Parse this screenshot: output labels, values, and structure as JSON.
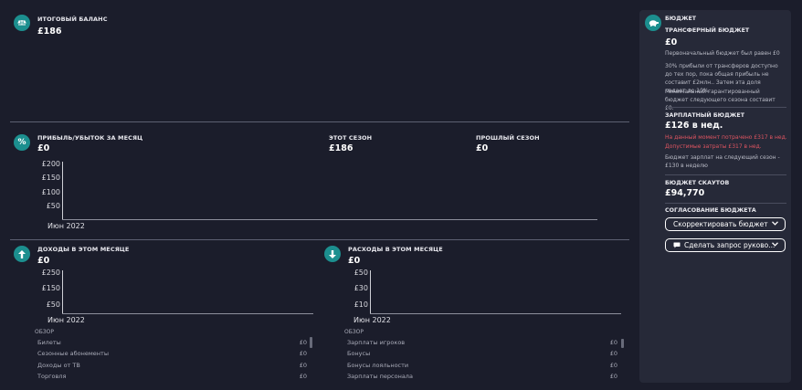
{
  "balance": {
    "title": "ИТОГОВЫЙ БАЛАНС",
    "value": "£186"
  },
  "monthly": {
    "title": "ПРИБЫЛЬ/УБЫТОК ЗА МЕСЯЦ",
    "value": "£0",
    "this_season_title": "ЭТОТ СЕЗОН",
    "this_season_value": "£186",
    "last_season_title": "ПРОШЛЫЙ СЕЗОН",
    "last_season_value": "£0",
    "ticks": [
      "£200",
      "£150",
      "£100",
      "£50"
    ],
    "xlabel": "Июн 2022"
  },
  "income": {
    "title": "ДОХОДЫ В ЭТОМ МЕСЯЦЕ",
    "value": "£0",
    "ticks": [
      "£250",
      "£150",
      "£50"
    ],
    "xlabel": "Июн 2022",
    "overview": "ОБЗОР",
    "rows": [
      {
        "label": "Билеты",
        "value": "£0"
      },
      {
        "label": "Сезонные абонементы",
        "value": "£0"
      },
      {
        "label": "Доходы от ТВ",
        "value": "£0"
      },
      {
        "label": "Торговля",
        "value": "£0"
      }
    ]
  },
  "expenses": {
    "title": "РАСХОДЫ В ЭТОМ МЕСЯЦЕ",
    "value": "£0",
    "ticks": [
      "£50",
      "£30",
      "£10"
    ],
    "xlabel": "Июн 2022",
    "overview": "ОБЗОР",
    "rows": [
      {
        "label": "Зарплаты игроков",
        "value": "£0"
      },
      {
        "label": "Бонусы",
        "value": "£0"
      },
      {
        "label": "Бонусы лояльности",
        "value": "£0"
      },
      {
        "label": "Зарплаты персонала",
        "value": "£0"
      }
    ]
  },
  "budget": {
    "header": "БЮДЖЕТ",
    "transfer_title": "ТРАНСФЕРНЫЙ БЮДЖЕТ",
    "transfer_value": "£0",
    "transfer_text1": "Первоначальный бюджет был равен £0",
    "transfer_text2": "30% прибыли от трансферов доступно до тех пор, пока общая прибыль не составит £2млн.. Затем эта доля падает до 10%.",
    "transfer_text3": "Минимальный гарантированный бюджет следующего сезона составит £0.",
    "wage_title": "ЗАРПЛАТНЫЙ БЮДЖЕТ",
    "wage_value": "£126 в нед.",
    "wage_spent": "На данный момент потрачено £317 в нед.",
    "wage_allowed": "Допустимые затраты £317 в нед.",
    "wage_next": "Бюджет зарплат на следующий сезон - £130 в неделю",
    "scout_title": "БЮДЖЕТ СКАУТОВ",
    "scout_value": "£94,770",
    "approval_title": "СОГЛАСОВАНИЕ БЮДЖЕТА",
    "adjust_button": "Скорректировать бюджет",
    "request_button": "Сделать запрос руково..."
  },
  "colors": {
    "accent": "#1c8f8f",
    "background": "#1b1d2b",
    "panel": "#262938",
    "warning": "#e05561"
  },
  "icons": {
    "balance": "scale-icon",
    "monthly": "percent-icon",
    "income": "arrow-up-icon",
    "expenses": "arrow-down-icon",
    "budget": "piggy-bank-icon",
    "chevron": "chevron-down-icon",
    "chat": "chat-bubble-icon"
  }
}
